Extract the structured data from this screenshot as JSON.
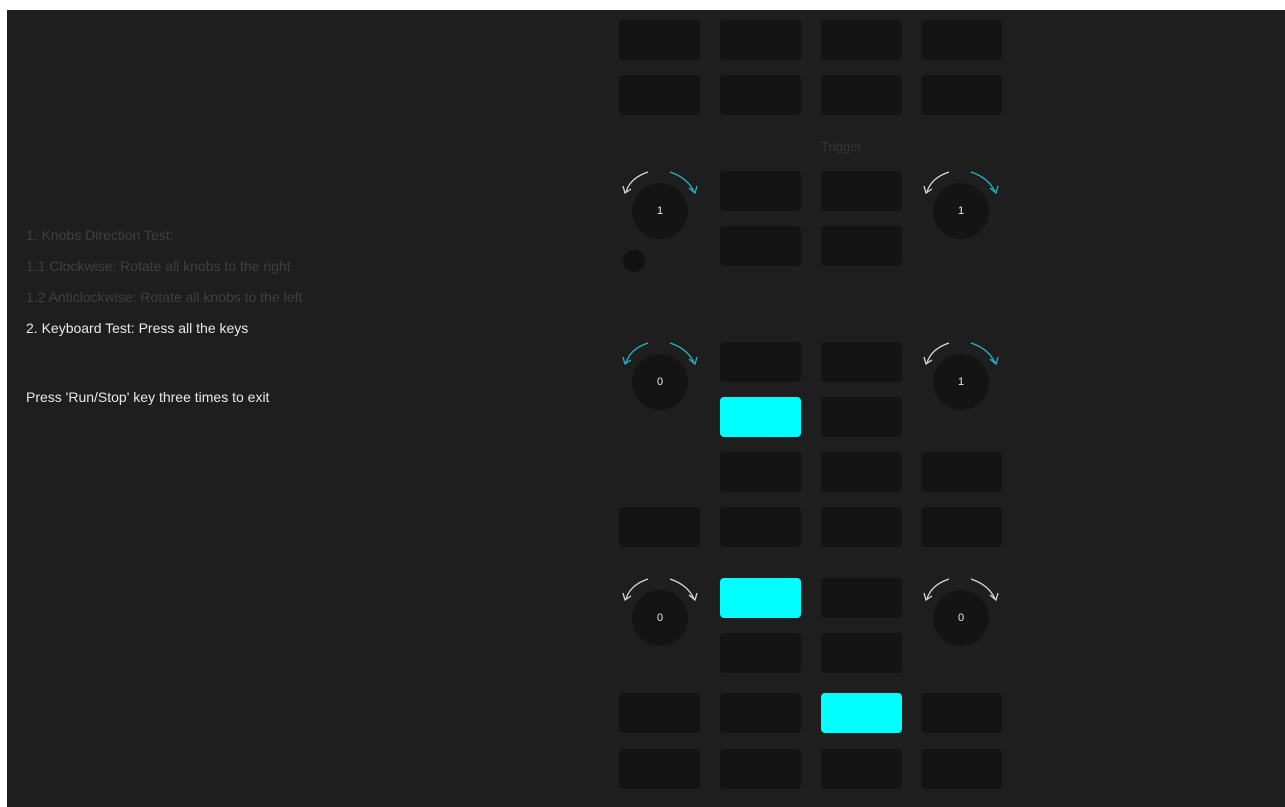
{
  "colors": {
    "background": "#1e1e1e",
    "key": "#141414",
    "key_pressed": "#00ffff",
    "arrow_done": "#1fb8c8",
    "arrow_pending": "#d8d8d8",
    "text_dim": "#3f3f3f",
    "text_bright": "#e8e8e8"
  },
  "instructions": {
    "line1": "1. Knobs Direction Test:",
    "line2": "1.1 Clockwise: Rotate all knobs to the right",
    "line3": "1.2 Anticlockwise: Rotate all knobs to the left",
    "line4": "2. Keyboard Test: Press all the keys",
    "exit": "Press 'Run/Stop' key three times to exit"
  },
  "panel": {
    "trigger_label": "Trigger",
    "knobs": [
      {
        "value": "1",
        "left_done": false,
        "right_done": true
      },
      {
        "value": "1",
        "left_done": false,
        "right_done": true
      },
      {
        "value": "0",
        "left_done": true,
        "right_done": true
      },
      {
        "value": "1",
        "left_done": false,
        "right_done": true
      },
      {
        "value": "0",
        "left_done": false,
        "right_done": false
      },
      {
        "value": "0",
        "left_done": false,
        "right_done": false
      }
    ],
    "keys_pressed": [
      false,
      false,
      false,
      false,
      false,
      false,
      false,
      false,
      false,
      false,
      false,
      false,
      false,
      false,
      false,
      false,
      false,
      false,
      false,
      false,
      false,
      false,
      false,
      false,
      false,
      false,
      false,
      false,
      false,
      false
    ]
  }
}
